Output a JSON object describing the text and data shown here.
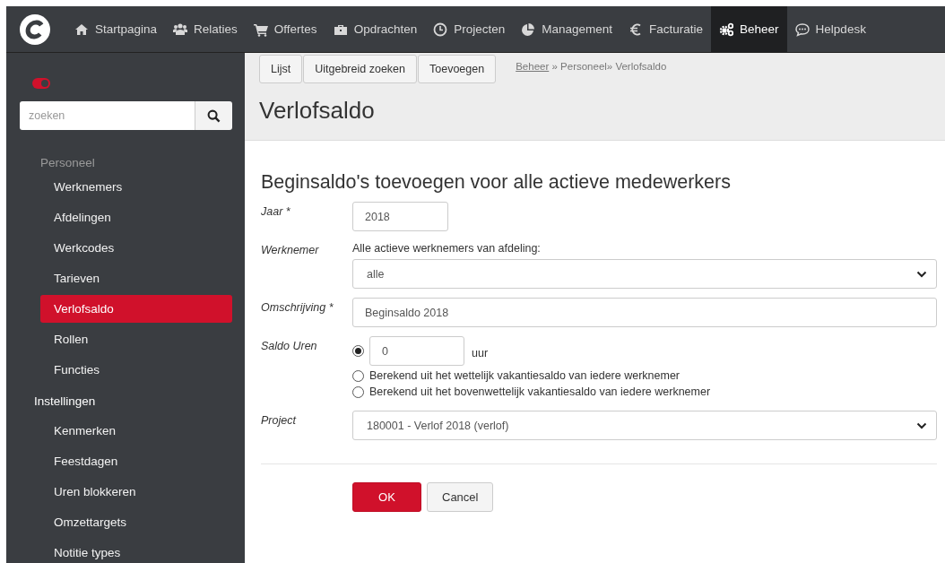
{
  "nav": {
    "items": [
      {
        "label": "Startpagina",
        "selected": false
      },
      {
        "label": "Relaties",
        "selected": false
      },
      {
        "label": "Offertes",
        "selected": false
      },
      {
        "label": "Opdrachten",
        "selected": false
      },
      {
        "label": "Projecten",
        "selected": false
      },
      {
        "label": "Management",
        "selected": false
      },
      {
        "label": "Facturatie",
        "selected": false
      },
      {
        "label": "Beheer",
        "selected": true
      },
      {
        "label": "Helpdesk",
        "selected": false
      }
    ]
  },
  "sidebar": {
    "toggle": {
      "on": true
    },
    "search": {
      "placeholder": "zoeken"
    },
    "groups": [
      {
        "label": "Personeel",
        "dim": true,
        "items": [
          {
            "label": "Werknemers",
            "selected": false
          },
          {
            "label": "Afdelingen",
            "selected": false
          },
          {
            "label": "Werkcodes",
            "selected": false
          },
          {
            "label": "Tarieven",
            "selected": false
          },
          {
            "label": "Verlofsaldo",
            "selected": true
          },
          {
            "label": "Rollen",
            "selected": false
          },
          {
            "label": "Functies",
            "selected": false
          }
        ]
      },
      {
        "label": "Instellingen",
        "dim": false,
        "items": [
          {
            "label": "Kenmerken",
            "selected": false
          },
          {
            "label": "Feestdagen",
            "selected": false
          },
          {
            "label": "Uren blokkeren",
            "selected": false
          },
          {
            "label": "Omzettargets",
            "selected": false
          },
          {
            "label": "Notitie types",
            "selected": false
          }
        ]
      }
    ]
  },
  "toolbar": {
    "buttons": [
      "Lijst",
      "Uitgebreid zoeken",
      "Toevoegen"
    ],
    "breadcrumb": {
      "link": "Beheer",
      "rest": "» Personeel» Verlofsaldo"
    }
  },
  "page_title": "Verlofsaldo",
  "form": {
    "heading": "Beginsaldo's toevoegen voor alle actieve medewerkers",
    "fields": [
      {
        "kind": "text",
        "label": "Jaar *",
        "value": "2018"
      },
      {
        "kind": "select",
        "label": "Werknemer",
        "hint": "Alle actieve werknemers van afdeling:",
        "value": "alle"
      },
      {
        "kind": "text",
        "label": "Omschrijving *",
        "value": "Beginsaldo 2018"
      },
      {
        "kind": "radios",
        "label": "Saldo Uren",
        "options": [
          {
            "kind": "amount",
            "selected": true,
            "value": "0",
            "unit": "uur"
          },
          {
            "kind": "text",
            "selected": false,
            "label": "Berekend uit het wettelijk vakantiesaldo van iedere werknemer"
          },
          {
            "kind": "text",
            "selected": false,
            "label": "Berekend uit het bovenwettelijk vakantiesaldo van iedere werknemer"
          }
        ]
      },
      {
        "kind": "select",
        "label": "Project",
        "value": "180001 - Verlof 2018 (verlof)"
      }
    ],
    "buttons": [
      {
        "label": "OK",
        "primary": true
      },
      {
        "label": "Cancel",
        "primary": false
      }
    ]
  }
}
